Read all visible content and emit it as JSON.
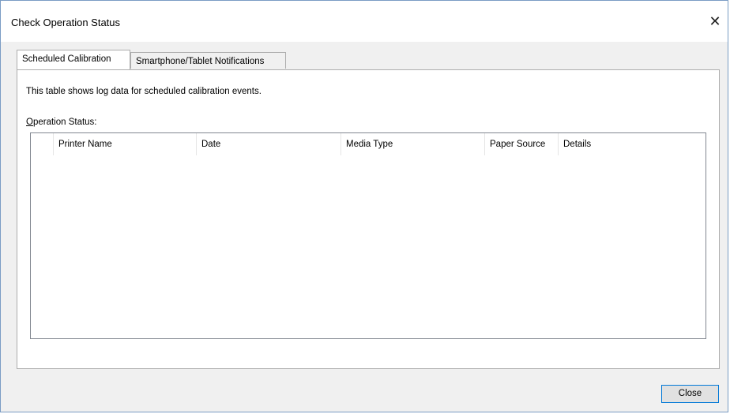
{
  "window": {
    "title": "Check Operation Status",
    "close_glyph": "✕"
  },
  "tabs": [
    {
      "label": "Scheduled Calibration",
      "selected": true
    },
    {
      "label": "Smartphone/Tablet Notifications",
      "selected": false
    }
  ],
  "panel": {
    "description": "This table shows log data for scheduled calibration events.",
    "status_label_accel": "O",
    "status_label_rest": "peration Status:"
  },
  "table": {
    "columns": [
      "",
      "Printer Name",
      "Date",
      "Media Type",
      "Paper Source",
      "Details"
    ],
    "rows": []
  },
  "footer": {
    "close_label": "Close"
  },
  "colors": {
    "accent": "#0078d7",
    "window_border": "#7a9cc4",
    "dialog_bg": "#f0f0f0"
  },
  "icons": {
    "close": "close-icon"
  }
}
